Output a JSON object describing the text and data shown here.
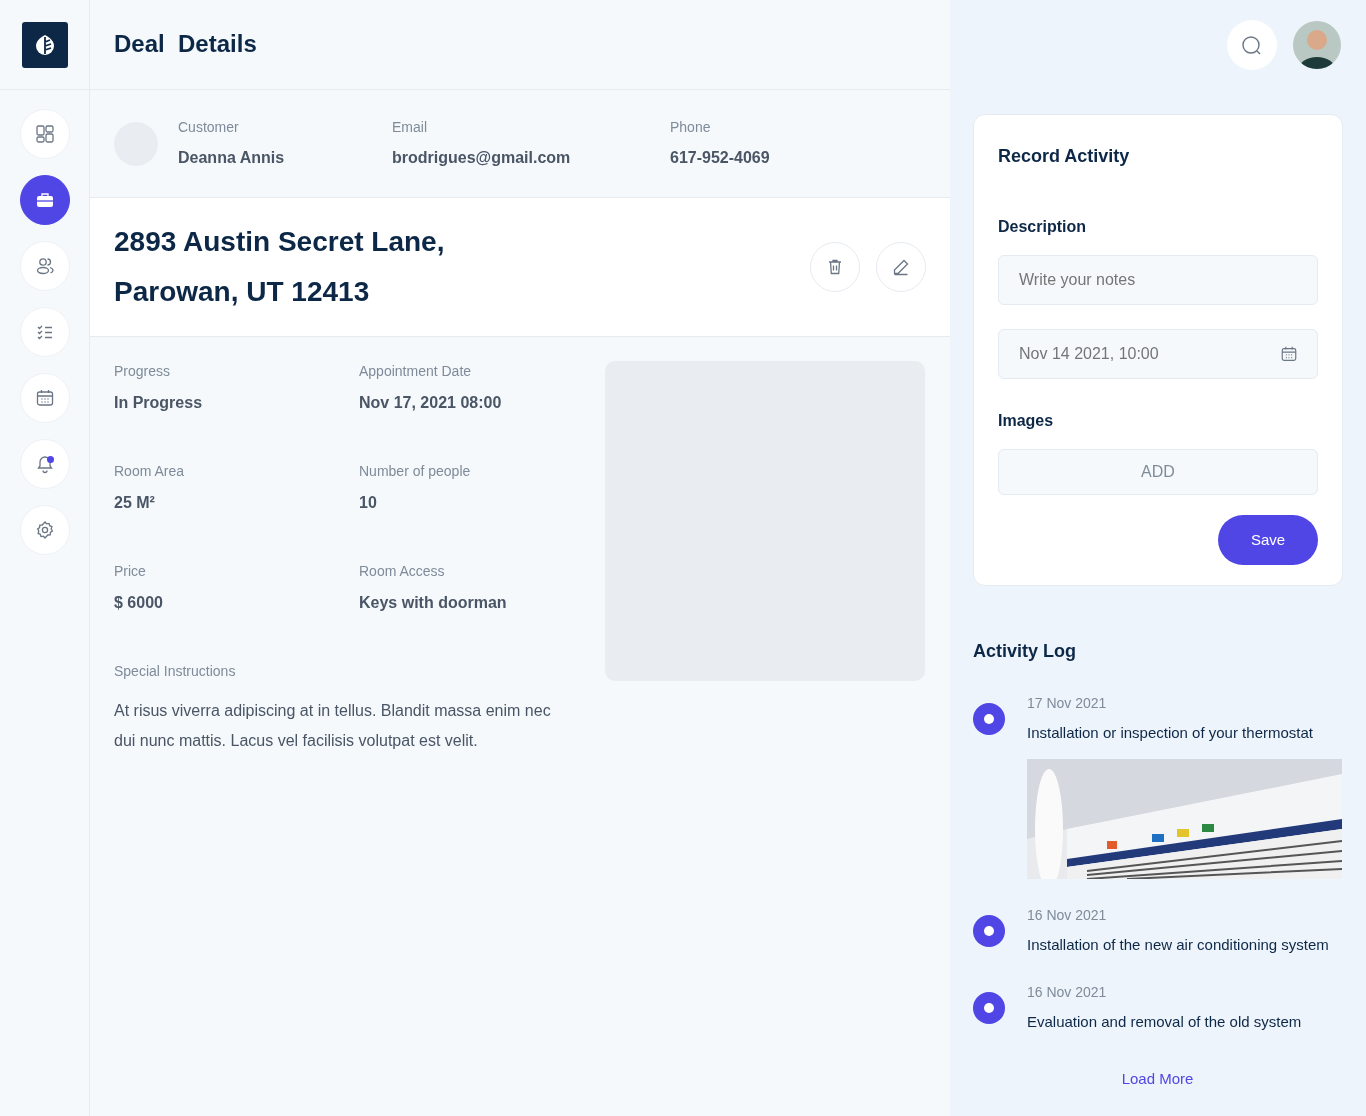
{
  "sidebar": {
    "items": [
      {
        "kind": "dashboard",
        "selected": false,
        "unread": false
      },
      {
        "kind": "deals",
        "selected": true,
        "unread": false
      },
      {
        "kind": "contacts",
        "selected": false,
        "unread": false
      },
      {
        "kind": "tasks",
        "selected": false,
        "unread": false
      },
      {
        "kind": "calendar",
        "selected": false,
        "unread": false
      },
      {
        "kind": "notifications",
        "selected": false,
        "unread": true
      },
      {
        "kind": "settings",
        "selected": false,
        "unread": false
      }
    ]
  },
  "header": {
    "title": "Deal  Details"
  },
  "customer": {
    "fields": [
      {
        "label": "Customer",
        "value": "Deanna Annis"
      },
      {
        "label": "Email",
        "value": "brodrigues@gmail.com"
      },
      {
        "label": "Phone",
        "value": "617-952-4069"
      }
    ]
  },
  "address": {
    "lines": [
      "2893 Austin Secret Lane,",
      "Parowan, UT 12413"
    ]
  },
  "details": {
    "fields": [
      {
        "label": "Progress",
        "value": "In Progress"
      },
      {
        "label": "Appointment Date",
        "value": "Nov 17, 2021 08:00"
      },
      {
        "label": "Room Area",
        "value": "25 M²"
      },
      {
        "label": "Number of people",
        "value": "10"
      },
      {
        "label": "Price",
        "value": "$ 6000"
      },
      {
        "label": "Room Access",
        "value": "Keys with doorman"
      }
    ],
    "instructions": {
      "label": "Special Instructions",
      "text": "At risus viverra adipiscing at in tellus. Blandit massa enim nec dui nunc mattis. Lacus vel facilisis volutpat est velit."
    }
  },
  "record_activity": {
    "title": "Record Activity",
    "description_label": "Description",
    "notes": {
      "placeholder": "Write your notes"
    },
    "date": {
      "placeholder": "Nov 14 2021, 10:00"
    },
    "images_label": "Images",
    "add_button": "ADD",
    "save_button": "Save"
  },
  "activity_log": {
    "title": "Activity Log",
    "items": [
      {
        "date": "17 Nov 2021",
        "text": "Installation or inspection of your thermostat"
      },
      {
        "date": "16 Nov 2021",
        "text": "Installation of the new air conditioning system"
      },
      {
        "date": "16 Nov 2021",
        "text": "Evaluation and removal of the old system"
      }
    ],
    "load_more": "Load More"
  }
}
